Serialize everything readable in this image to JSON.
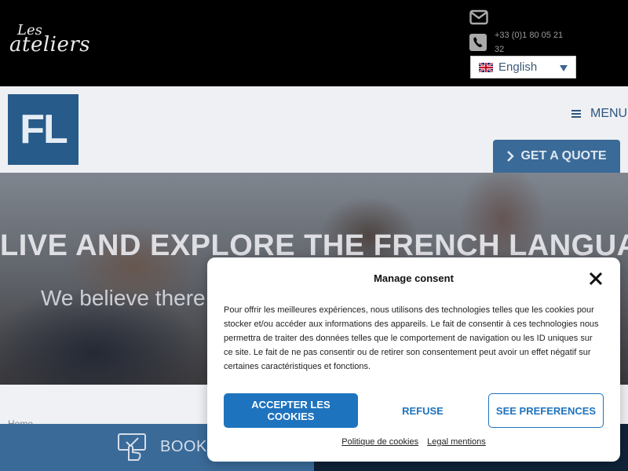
{
  "topbar": {
    "logo_small": "Les",
    "logo_large": "ateliers",
    "phone_text": "+33 (0)1 80 05 21 32",
    "language": "English"
  },
  "navbar": {
    "logo_text": "FL",
    "menu_label": "MENU",
    "quote_label": "GET A QUOTE"
  },
  "hero": {
    "title": "LIVE AND EXPLORE THE FRENCH LANGUAGE",
    "subtitle": "We believe there"
  },
  "breadcrumb": "Home",
  "bottom_bar": {
    "book_label": "BOOK"
  },
  "consent": {
    "title": "Manage consent",
    "body": "Pour offrir les meilleures expériences, nous utilisons des technologies telles que les cookies pour stocker et/ou accéder aux informations des appareils. Le fait de consentir à ces technologies nous permettra de traiter des données telles que le comportement de navigation ou les ID uniques sur ce site. Le fait de ne pas consentir ou de retirer son consentement peut avoir un effet négatif sur certaines caractéristiques et fonctions.",
    "accept_label": "ACCEPTER LES COOKIES",
    "refuse_label": "REFUSE",
    "prefs_label": "SEE PREFERENCES",
    "link_cookies": "Politique de cookies",
    "link_legal": "Legal mentions"
  },
  "colors": {
    "brand_blue": "#275b8a",
    "accent_button": "#1e73be",
    "topbar_bg": "#000000"
  }
}
